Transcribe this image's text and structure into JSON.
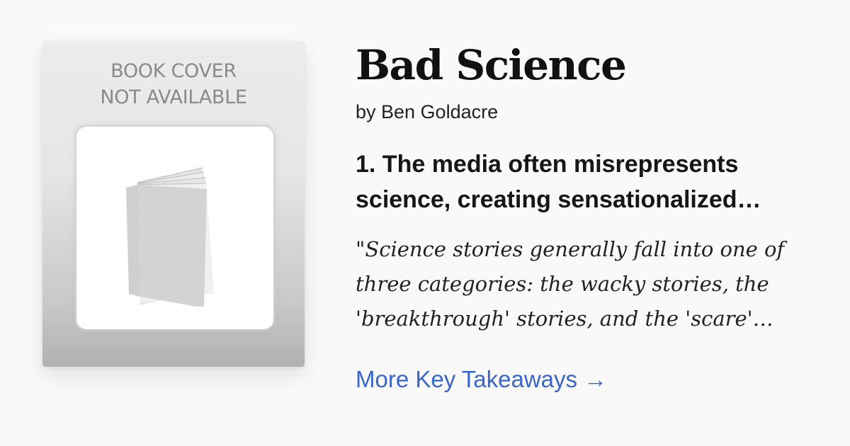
{
  "cover": {
    "line1": "BOOK COVER",
    "line2": "NOT AVAILABLE",
    "icon": "book-icon"
  },
  "book": {
    "title": "Bad Science",
    "author": "by Ben Goldacre"
  },
  "takeaway": {
    "line1": "1. The media often misrepresents",
    "line2": "science, creating sensationalized…"
  },
  "quote": {
    "line1": "\"Science stories generally fall into one of",
    "line2": "three categories: the wacky stories, the",
    "line3": "'breakthrough' stories, and the 'scare'…"
  },
  "link": {
    "label": "More Key Takeaways →",
    "color": "#3a66cc"
  }
}
